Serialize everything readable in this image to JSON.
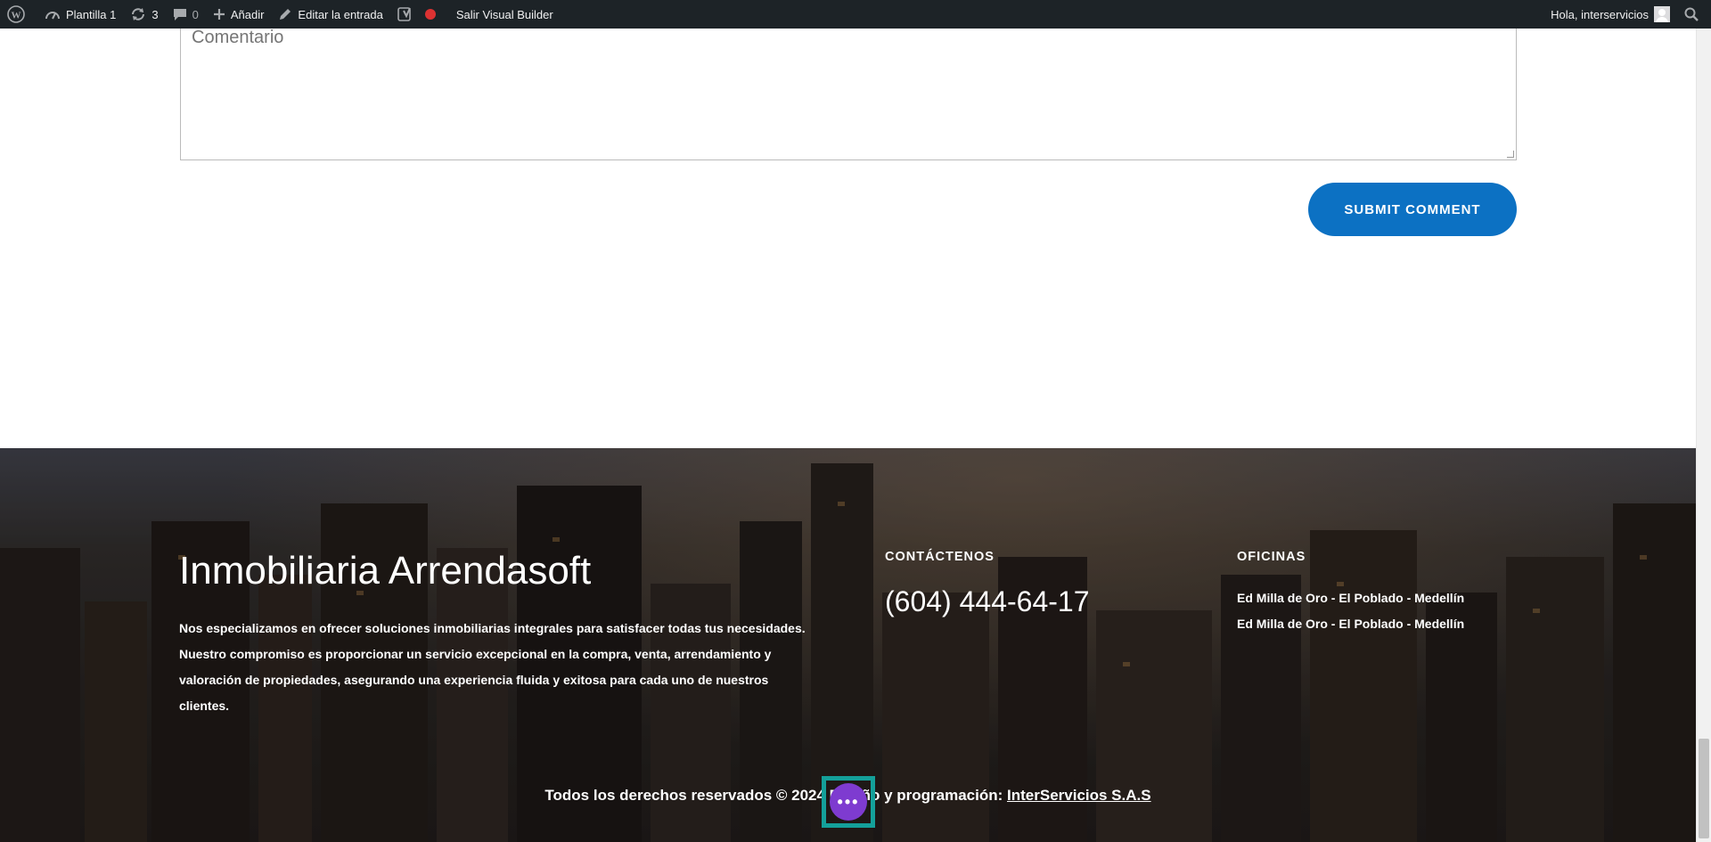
{
  "admin_bar": {
    "site_name": "Plantilla 1",
    "updates_count": "3",
    "comments_count": "0",
    "add_label": "Añadir",
    "edit_label": "Editar la entrada",
    "exit_builder_label": "Salir Visual Builder",
    "greeting": "Hola, interservicios"
  },
  "comment_form": {
    "placeholder": "Comentario",
    "submit_label": "SUBMIT COMMENT"
  },
  "footer": {
    "title": "Inmobiliaria Arrendasoft",
    "description": "Nos especializamos en ofrecer soluciones inmobiliarias integrales para satisfacer todas tus necesidades. Nuestro compromiso es proporcionar un servicio excepcional en la compra, venta, arrendamiento y valoración de propiedades, asegurando una experiencia fluida y exitosa para cada uno de nuestros clientes.",
    "contact_heading": "CONTÁCTENOS",
    "phone": "(604) 444-64-17",
    "offices_heading": "OFICINAS",
    "offices": [
      "Ed Milla de Oro - El Poblado - Medellín",
      "Ed Milla de Oro - El Poblado - Medellín"
    ],
    "copyright_text": "Todos los derechos reservados © 2024 Diseño y programación:",
    "copyright_link": "InterServicios S.A.S"
  },
  "colors": {
    "admin_bar_bg": "#1d2327",
    "submit_button": "#0c71c3",
    "fab": "#7e3bd0",
    "fab_outline": "#14a09a"
  }
}
